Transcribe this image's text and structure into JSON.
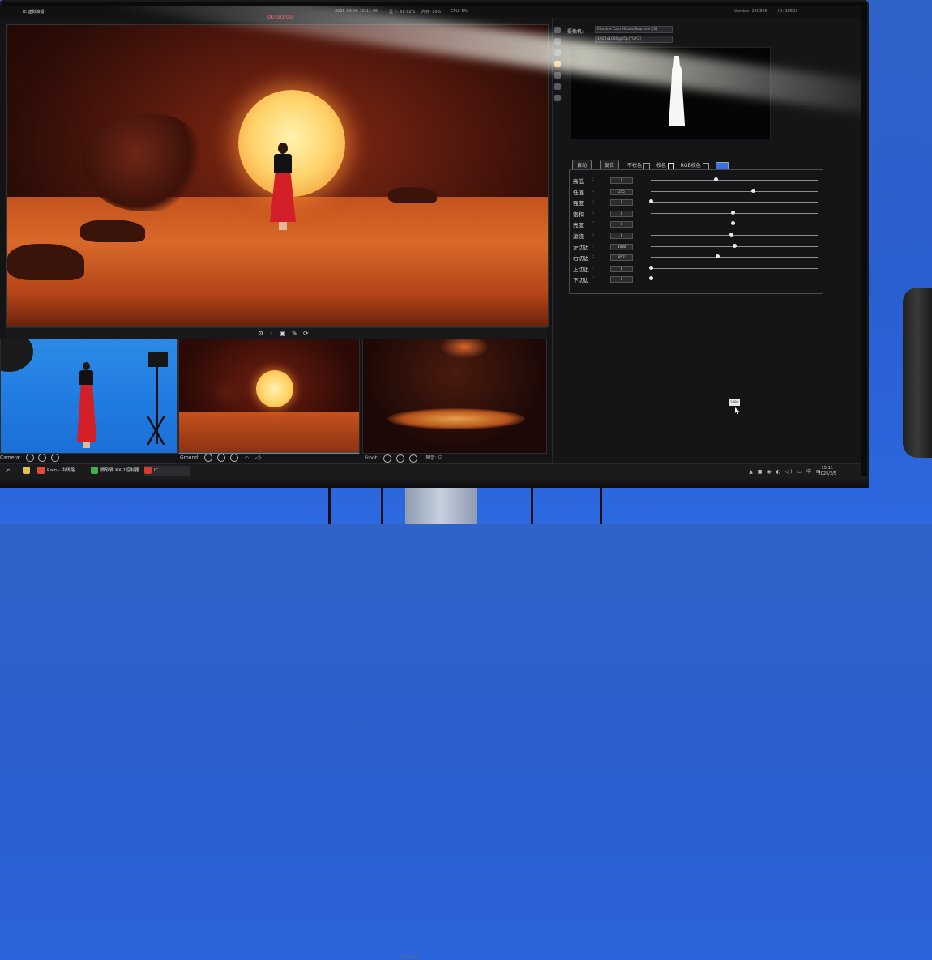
{
  "topbar": {
    "app_name": "IC 虚拟演播",
    "recording_timer": "00:00:00",
    "datetime": "2025-03-05 15:11:06",
    "gpu": "显卡: 60 62%",
    "memory": "内存: 20%",
    "cpu": "CPU: 5%",
    "version": "Version: 250306",
    "id": "ID: 10503"
  },
  "main_controls": [
    "⚙",
    "‹",
    "▣",
    "✎",
    "⟳"
  ],
  "thumbnails": {
    "camera": {
      "label": "Camera:"
    },
    "ground": {
      "label": "Ground:"
    },
    "front": {
      "label": "Front:",
      "display_label": "显示:"
    }
  },
  "right_panel": {
    "camera_label": "摄像机:",
    "camera_device": "Elecline Cam HCam(Searcher)[0]",
    "camera_format": "1920x1080@25p[YUY2]",
    "buttons": {
      "auto": "自动",
      "reset": "复位",
      "no_key": "不校色",
      "key": "校色",
      "rgb_key": "RGB校色"
    },
    "key_color": "#3c6ee6",
    "params": [
      {
        "label": "高低",
        "value": "0",
        "level": 0.39
      },
      {
        "label": "低值",
        "value": "255",
        "level": 0.61
      },
      {
        "label": "强度",
        "value": "0",
        "level": 0.0
      },
      {
        "label": "饱和",
        "value": "0",
        "level": 0.49
      },
      {
        "label": "亮度",
        "value": "0",
        "level": 0.49
      },
      {
        "label": "滤镜",
        "value": "0",
        "level": 0.48
      },
      {
        "label": "左切边",
        "value": "1080",
        "level": 0.5
      },
      {
        "label": "右切边",
        "value": "857",
        "level": 0.4
      },
      {
        "label": "上切边",
        "value": "0",
        "level": 0.0
      },
      {
        "label": "下切边",
        "value": "0",
        "level": 0.0
      }
    ],
    "tooltip": "1080"
  },
  "taskbar": {
    "search_icon": "search-icon",
    "items": [
      {
        "label": "Rain - 由线路",
        "color": "#e24b3b"
      },
      {
        "label": "微软雅 KX-2控制器...",
        "color": "#44b04a"
      },
      {
        "label": "IC",
        "color": "#d93a2b"
      }
    ],
    "tray": "▲ ■ ◉ ◐ ◁) ▭ 中 ⊞",
    "time": "15:11",
    "date": "2025/3/5"
  },
  "monitor_brand": "xiaomi"
}
